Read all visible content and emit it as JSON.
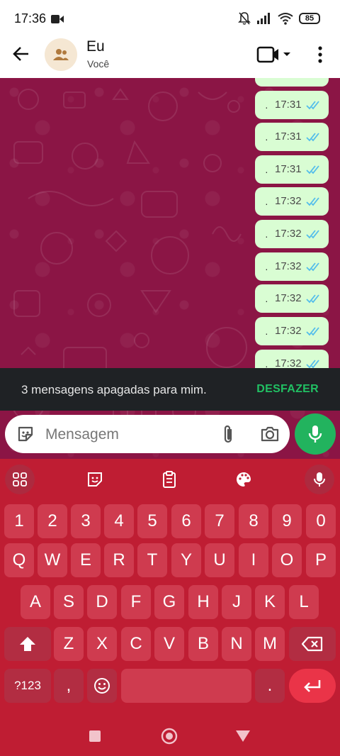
{
  "status_bar": {
    "time": "17:36",
    "battery": "85"
  },
  "header": {
    "title": "Eu",
    "subtitle": "Você"
  },
  "messages": [
    {
      "time": "17:31"
    },
    {
      "time": "17:31"
    },
    {
      "time": "17:31"
    },
    {
      "time": "17:32"
    },
    {
      "time": "17:32"
    },
    {
      "time": "17:32"
    },
    {
      "time": "17:32"
    },
    {
      "time": "17:32"
    },
    {
      "time": "17:32"
    }
  ],
  "snackbar": {
    "message": "3 mensagens apagadas para mim.",
    "action": "DESFAZER"
  },
  "composer": {
    "placeholder": "Mensagem"
  },
  "keyboard": {
    "numbers": [
      "1",
      "2",
      "3",
      "4",
      "5",
      "6",
      "7",
      "8",
      "9",
      "0"
    ],
    "row1": [
      "Q",
      "W",
      "E",
      "R",
      "T",
      "Y",
      "U",
      "I",
      "O",
      "P"
    ],
    "row2": [
      "A",
      "S",
      "D",
      "F",
      "G",
      "H",
      "J",
      "K",
      "L"
    ],
    "row3": [
      "Z",
      "X",
      "C",
      "V",
      "B",
      "N",
      "M"
    ],
    "symbols_key": "?123",
    "comma_key": ",",
    "period_key": "."
  },
  "colors": {
    "chat_background": "#8b1545",
    "bubble": "#d9fdd3",
    "keyboard": "#bf1d33",
    "key": "#cf3b4f",
    "accent_green": "#21c063",
    "read_tick": "#53bdeb"
  }
}
